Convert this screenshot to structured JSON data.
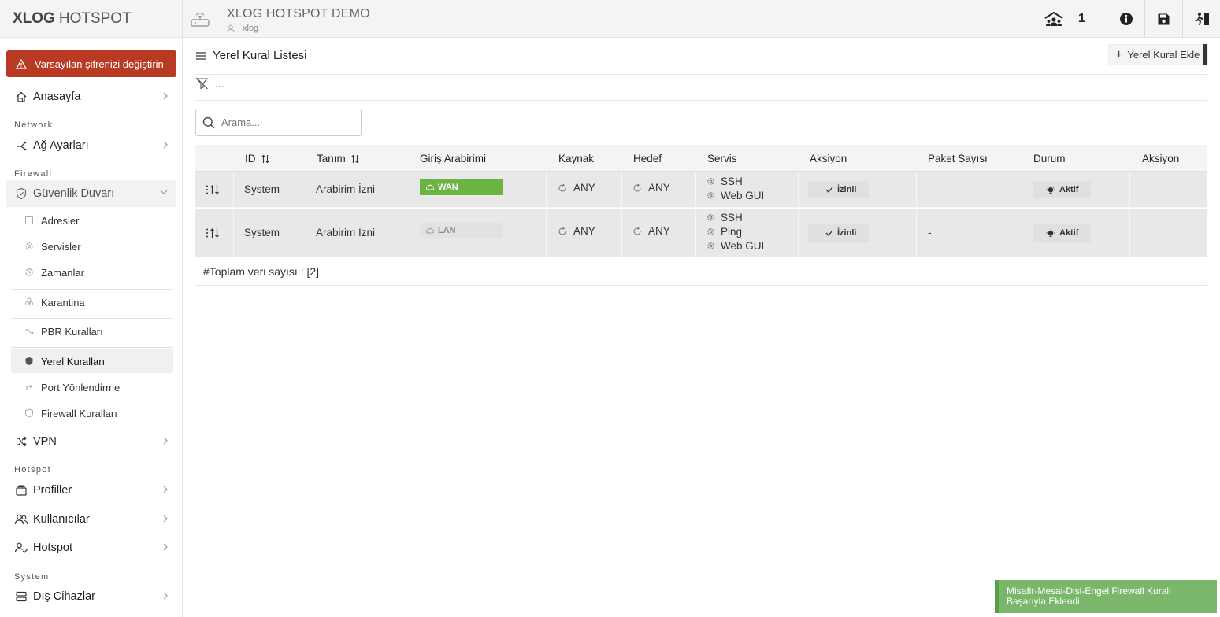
{
  "sidebar": {
    "brand_bold": "XLOG",
    "brand_light": "HOTSPOT",
    "alert": "Varsayılan şifrenizi değiştirin",
    "home": "Anasayfa",
    "section_network": "Network",
    "network_settings": "Ağ Ayarları",
    "section_firewall": "Firewall",
    "firewall_group": "Güvenlik Duvarı",
    "firewall_items": {
      "addresses": "Adresler",
      "services": "Servisler",
      "schedules": "Zamanlar",
      "quarantine": "Karantina",
      "pbr": "PBR Kuralları",
      "local_rules": "Yerel Kuralları",
      "port_forward": "Port Yönlendirme",
      "firewall_rules": "Firewall Kuralları"
    },
    "vpn": "VPN",
    "section_hotspot": "Hotspot",
    "profiles": "Profiller",
    "users": "Kullanıcılar",
    "hotspot": "Hotspot",
    "section_system": "System",
    "external_devices": "Dış Cihazlar"
  },
  "header": {
    "title": "XLOG HOTSPOT DEMO",
    "username": "xlog",
    "online_count": "1"
  },
  "content": {
    "title": "Yerel Kural Listesi",
    "add_button": "Yerel Kural Ekle",
    "filter_text": "...",
    "search_placeholder": "Arama...",
    "total_label": "#Toplam veri sayısı : [2]"
  },
  "table": {
    "headers": {
      "id": "ID",
      "description": "Tanım",
      "input_interface": "Giriş Arabirimi",
      "source": "Kaynak",
      "destination": "Hedef",
      "service": "Servis",
      "action": "Aksiyon",
      "packet_count": "Paket Sayısı",
      "status": "Durum",
      "actions": "Aksiyon"
    },
    "rows": [
      {
        "id": "System",
        "description": "Arabirim İzni",
        "interface": "WAN",
        "source": "ANY",
        "destination": "ANY",
        "services": [
          "SSH",
          "Web GUI"
        ],
        "action": "İzinli",
        "packets": "-",
        "status": "Aktif"
      },
      {
        "id": "System",
        "description": "Arabirim İzni",
        "interface": "LAN",
        "source": "ANY",
        "destination": "ANY",
        "services": [
          "SSH",
          "Ping",
          "Web GUI"
        ],
        "action": "İzinli",
        "packets": "-",
        "status": "Aktif"
      }
    ]
  },
  "toast": {
    "message": "Misafir-Mesai-Disi-Engel Firewall Kuralı Başarıyla Eklendi"
  },
  "colors": {
    "alert_bg": "#b83a23",
    "wan_badge": "#6bb443",
    "toast_bg": "#7bb76a"
  }
}
